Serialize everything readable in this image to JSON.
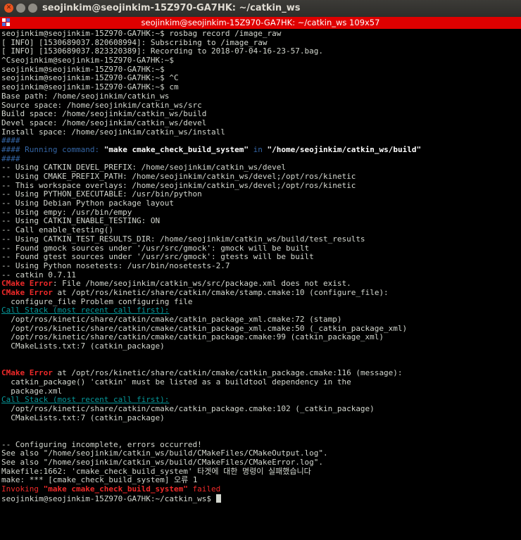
{
  "window": {
    "title": "seojinkim@seojinkim-15Z970-GA7HK: ~/catkin_ws",
    "tab_title": "seojinkim@seojinkim-15Z970-GA7HK: ~/catkin_ws 109x57",
    "close_glyph": "✕"
  },
  "colors": {
    "tab_bar": "#df0000",
    "error_red": "#ef2929",
    "header_blue": "#3465a4",
    "link_cyan": "#06989a",
    "text": "#d3d7cf",
    "background": "#000000"
  },
  "terminal": {
    "lines": [
      "seojinkim@seojinkim-15Z970-GA7HK:~$ rosbag record /image_raw",
      "[ INFO] [1530689037.820608994]: Subscribing to /image_raw",
      "[ INFO] [1530689037.823320389]: Recording to 2018-07-04-16-23-57.bag.",
      "^Cseojinkim@seojinkim-15Z970-GA7HK:~$",
      "seojinkim@seojinkim-15Z970-GA7HK:~$",
      "seojinkim@seojinkim-15Z970-GA7HK:~$ ^C",
      "seojinkim@seojinkim-15Z970-GA7HK:~$ cm",
      "Base path: /home/seojinkim/catkin_ws",
      "Source space: /home/seojinkim/catkin_ws/src",
      "Build space: /home/seojinkim/catkin_ws/build",
      "Devel space: /home/seojinkim/catkin_ws/devel",
      "Install space: /home/seojinkim/catkin_ws/install",
      "####",
      "#### Running command: ",
      "####",
      "-- Using CATKIN_DEVEL_PREFIX: /home/seojinkim/catkin_ws/devel",
      "-- Using CMAKE_PREFIX_PATH: /home/seojinkim/catkin_ws/devel;/opt/ros/kinetic",
      "-- This workspace overlays: /home/seojinkim/catkin_ws/devel;/opt/ros/kinetic",
      "-- Using PYTHON_EXECUTABLE: /usr/bin/python",
      "-- Using Debian Python package layout",
      "-- Using empy: /usr/bin/empy",
      "-- Using CATKIN_ENABLE_TESTING: ON",
      "-- Call enable_testing()",
      "-- Using CATKIN_TEST_RESULTS_DIR: /home/seojinkim/catkin_ws/build/test_results",
      "-- Found gmock sources under '/usr/src/gmock': gmock will be built",
      "-- Found gtest sources under '/usr/src/gmock': gtests will be built",
      "-- Using Python nosetests: /usr/bin/nosetests-2.7",
      "-- catkin 0.7.11",
      "CMake Error",
      ": File /home/seojinkim/catkin_ws/src/package.xml does not exist.",
      "CMake Error",
      " at /opt/ros/kinetic/share/catkin/cmake/stamp.cmake:10 (configure_file):",
      "  configure_file Problem configuring file",
      "Call Stack (most recent call first):",
      "  /opt/ros/kinetic/share/catkin/cmake/catkin_package_xml.cmake:72 (stamp)",
      "  /opt/ros/kinetic/share/catkin/cmake/catkin_package_xml.cmake:50 (_catkin_package_xml)",
      "  /opt/ros/kinetic/share/catkin/cmake/catkin_package.cmake:99 (catkin_package_xml)",
      "  CMakeLists.txt:7 (catkin_package)",
      "CMake Error",
      " at /opt/ros/kinetic/share/catkin/cmake/catkin_package.cmake:116 (message):",
      "  catkin_package() 'catkin' must be listed as a buildtool dependency in the",
      "  package.xml",
      "Call Stack (most recent call first):",
      "  /opt/ros/kinetic/share/catkin/cmake/catkin_package.cmake:102 (_catkin_package)",
      "  CMakeLists.txt:7 (catkin_package)",
      "-- Configuring incomplete, errors occurred!",
      "See also \"/home/seojinkim/catkin_ws/build/CMakeFiles/CMakeOutput.log\".",
      "See also \"/home/seojinkim/catkin_ws/build/CMakeFiles/CMakeError.log\".",
      "Makefile:1662: 'cmake_check_build_system' 타겟에 대한 명령이 실패했습니다",
      "make: *** [cmake_check_build_system] 오류 1",
      "Invoking ",
      "\"make cmake_check_build_system\"",
      " failed",
      "seojinkim@seojinkim-15Z970-GA7HK:~/catkin_ws$ "
    ],
    "running_command": "\"make cmake_check_build_system\"",
    "running_in": " in ",
    "running_dir": "\"/home/seojinkim/catkin_ws/build\""
  }
}
